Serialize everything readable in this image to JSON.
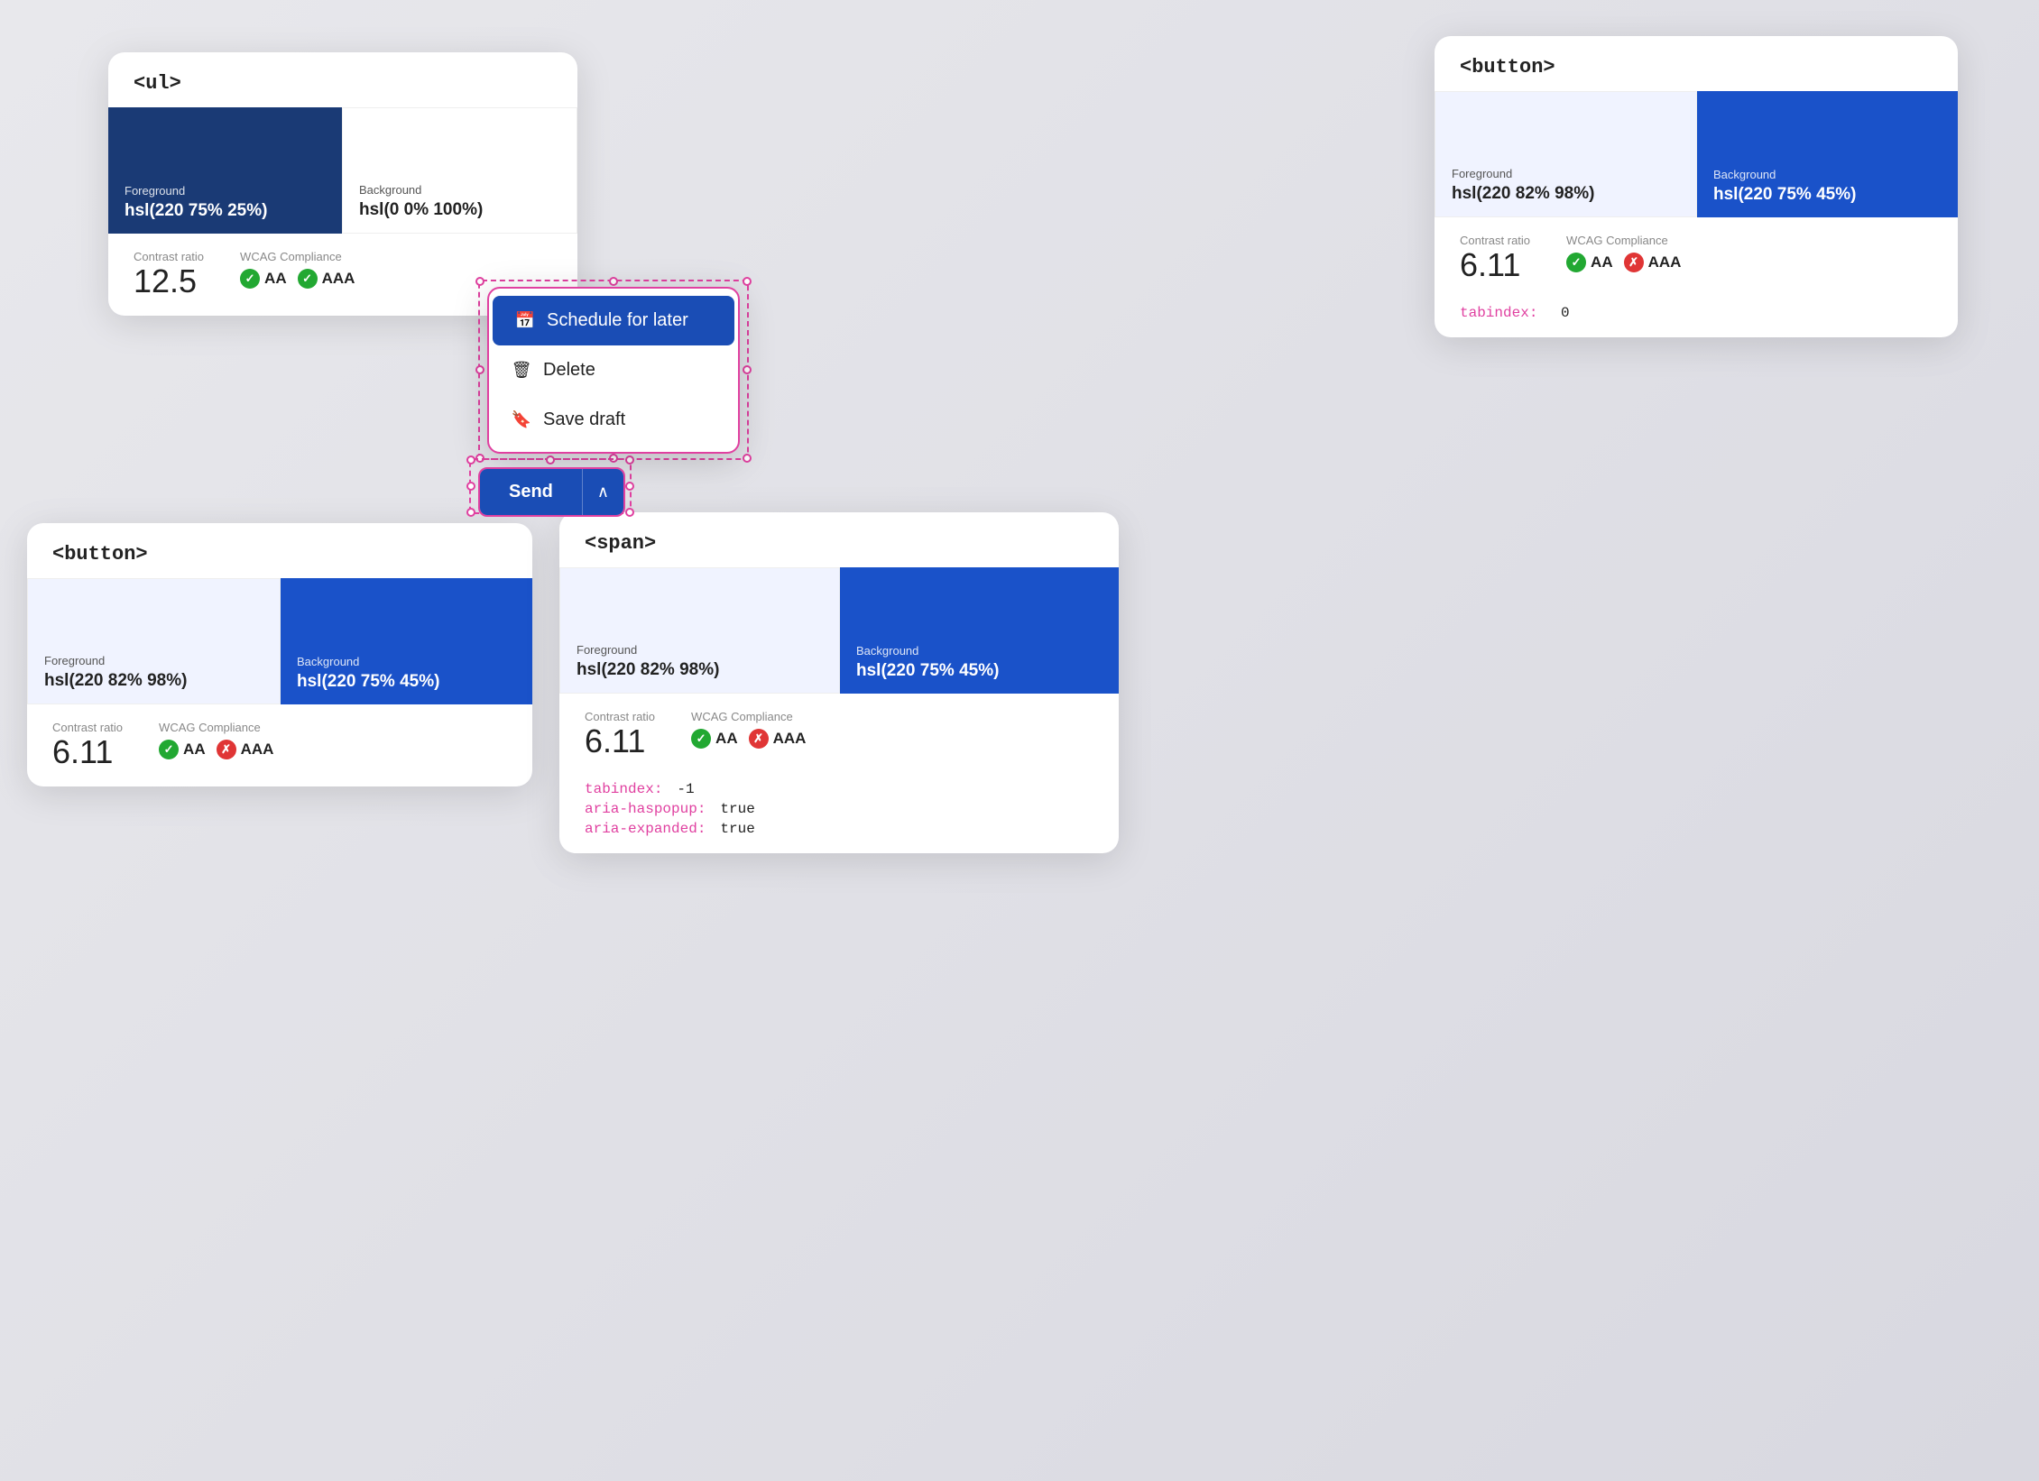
{
  "cards": {
    "ul_card": {
      "title": "<ul>",
      "swatch_fg": {
        "label": "Foreground",
        "value": "hsl(220 75% 25%)",
        "bg_color": "#1a3a75"
      },
      "swatch_bg": {
        "label": "Background",
        "value": "hsl(0 0% 100%)",
        "bg_color": "#ffffff",
        "text_dark": true
      },
      "contrast_ratio_label": "Contrast ratio",
      "contrast_ratio_value": "12.5",
      "wcag_label": "WCAG Compliance",
      "badges": [
        {
          "label": "AA",
          "pass": true
        },
        {
          "label": "AAA",
          "pass": true
        }
      ]
    },
    "button_top": {
      "title": "<button>",
      "swatch_fg": {
        "label": "Foreground",
        "value": "hsl(220 82% 98%)",
        "bg_color": "#f0f3ff",
        "text_dark": true
      },
      "swatch_bg": {
        "label": "Background",
        "value": "hsl(220 75% 45%)",
        "bg_color": "#1a52c9"
      },
      "contrast_ratio_label": "Contrast ratio",
      "contrast_ratio_value": "6.11",
      "wcag_label": "WCAG Compliance",
      "badges": [
        {
          "label": "AA",
          "pass": true
        },
        {
          "label": "AAA",
          "pass": false
        }
      ],
      "tabindex_label": "tabindex:",
      "tabindex_value": "0"
    },
    "button_bottom": {
      "title": "<button>",
      "swatch_fg": {
        "label": "Foreground",
        "value": "hsl(220 82% 98%)",
        "bg_color": "#f0f3ff",
        "text_dark": true
      },
      "swatch_bg": {
        "label": "Background",
        "value": "hsl(220 75% 45%)",
        "bg_color": "#1a52c9"
      },
      "contrast_ratio_label": "Contrast ratio",
      "contrast_ratio_value": "6.11",
      "wcag_label": "WCAG Compliance",
      "badges": [
        {
          "label": "AA",
          "pass": true
        },
        {
          "label": "AAA",
          "pass": false
        }
      ]
    },
    "span_card": {
      "title": "<span>",
      "swatch_fg": {
        "label": "Foreground",
        "value": "hsl(220 82% 98%)",
        "bg_color": "#f0f3ff",
        "text_dark": true
      },
      "swatch_bg": {
        "label": "Background",
        "value": "hsl(220 75% 45%)",
        "bg_color": "#1a52c9"
      },
      "contrast_ratio_label": "Contrast ratio",
      "contrast_ratio_value": "6.11",
      "wcag_label": "WCAG Compliance",
      "badges": [
        {
          "label": "AA",
          "pass": true
        },
        {
          "label": "AAA",
          "pass": false
        }
      ],
      "attrs": [
        {
          "key": "tabindex:",
          "value": "-1"
        },
        {
          "key": "aria-haspopup:",
          "value": "true"
        },
        {
          "key": "aria-expanded:",
          "value": "true"
        }
      ]
    }
  },
  "dropdown": {
    "items": [
      {
        "label": "Schedule for later",
        "icon": "📅",
        "active": true
      },
      {
        "label": "Delete",
        "icon": "🗑"
      },
      {
        "label": "Save draft",
        "icon": "🔖"
      }
    ]
  },
  "send_button": {
    "label": "Send",
    "chevron": "∧"
  }
}
